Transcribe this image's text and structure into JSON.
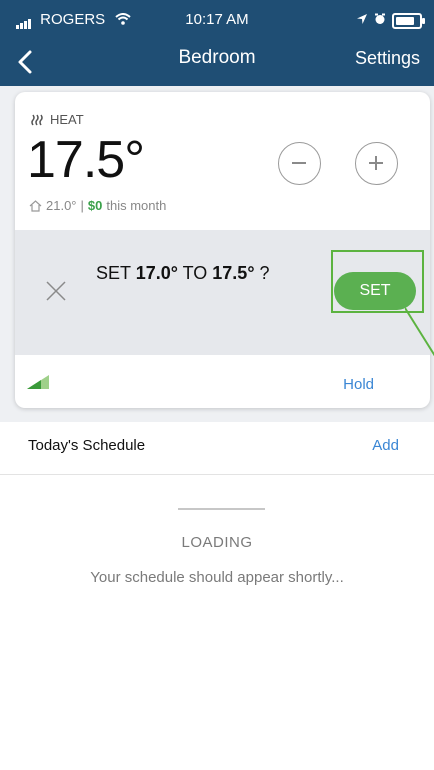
{
  "status_bar": {
    "carrier": "ROGERS",
    "time": "10:17 AM"
  },
  "nav": {
    "title": "Bedroom",
    "settings_label": "Settings"
  },
  "thermostat": {
    "mode_label": "HEAT",
    "setpoint": "17.5°",
    "current_temp": "21.0°",
    "separator": "|",
    "cost_value": "$0",
    "cost_suffix": "this month"
  },
  "confirm": {
    "prefix": "SET ",
    "from_value": "17.0°",
    "middle": " TO ",
    "to_value": "17.5°",
    "suffix": " ?",
    "set_button_label": "SET"
  },
  "controls": {
    "hold_label": "Hold"
  },
  "schedule": {
    "title": "Today's Schedule",
    "add_label": "Add",
    "loading_label": "LOADING",
    "loading_message": "Your schedule should appear shortly..."
  },
  "colors": {
    "header_bg": "#1f4e74",
    "accent_green": "#5bb051",
    "link_blue": "#3a86d4"
  }
}
